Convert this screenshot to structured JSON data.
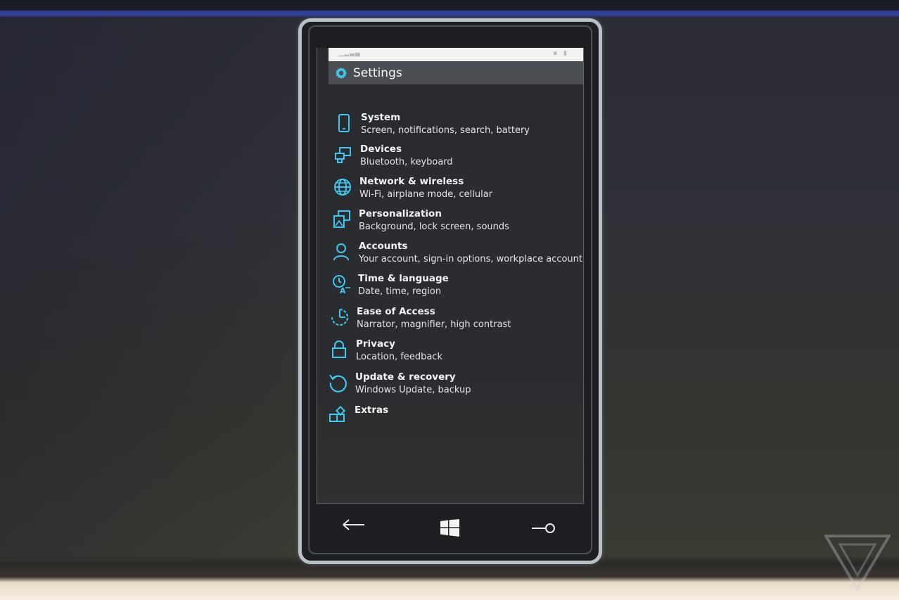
{
  "header": {
    "title": "Settings",
    "gear_icon": "gear-icon"
  },
  "accent_color": "#3cc8f0",
  "items": [
    {
      "icon": "phone-icon",
      "title": "System",
      "subtitle": "Screen, notifications, search, battery"
    },
    {
      "icon": "devices-icon",
      "title": "Devices",
      "subtitle": "Bluetooth, keyboard"
    },
    {
      "icon": "globe-icon",
      "title": "Network & wireless",
      "subtitle": "Wi-Fi, airplane mode, cellular"
    },
    {
      "icon": "personalization-icon",
      "title": "Personalization",
      "subtitle": "Background, lock screen, sounds"
    },
    {
      "icon": "person-icon",
      "title": "Accounts",
      "subtitle": "Your account, sign-in options, workplace account"
    },
    {
      "icon": "time-language-icon",
      "title": "Time & language",
      "subtitle": "Date, time, region"
    },
    {
      "icon": "ease-of-access-icon",
      "title": "Ease of Access",
      "subtitle": "Narrator, magnifier, high contrast"
    },
    {
      "icon": "lock-icon",
      "title": "Privacy",
      "subtitle": "Location, feedback"
    },
    {
      "icon": "update-icon",
      "title": "Update & recovery",
      "subtitle": "Windows Update, backup"
    },
    {
      "icon": "extras-icon",
      "title": "Extras",
      "subtitle": ""
    }
  ],
  "navbar": {
    "back": "back-arrow-icon",
    "start": "windows-logo-icon",
    "search": "search-icon"
  }
}
